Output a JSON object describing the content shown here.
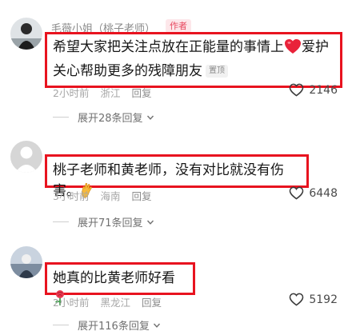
{
  "comments": [
    {
      "username": "毛薇小姐（桃子老师）",
      "author_tag": "作者",
      "text_line1": "希望大家把关注点放在正能量的事情上",
      "text_line1_tail": "爱护",
      "text_line2": "关心帮助更多的残障朋友",
      "pinned_label": "置顶",
      "time": "2小时前",
      "location": "浙江",
      "reply_label": "回复",
      "likes": "2146",
      "expand_label": "展开28条回复"
    },
    {
      "text": "桃子老师和黄老师，没有对比就没有伤害。",
      "time": "3小时前",
      "location": "海南",
      "reply_label": "回复",
      "likes": "6448",
      "expand_label": "展开71条回复"
    },
    {
      "text": "她真的比黄老师好看",
      "time": "2小时前",
      "location": "黑龙江",
      "reply_label": "回复",
      "likes": "5192",
      "expand_label": "展开116条回复"
    }
  ],
  "icons": [
    "heart-emoji-icon",
    "hand-emoji-icon",
    "rose-emoji-icon",
    "like-heart-icon",
    "chevron-down-icon"
  ],
  "colors": {
    "highlight_border": "#e8131f",
    "author_tag": "#e8485f"
  }
}
